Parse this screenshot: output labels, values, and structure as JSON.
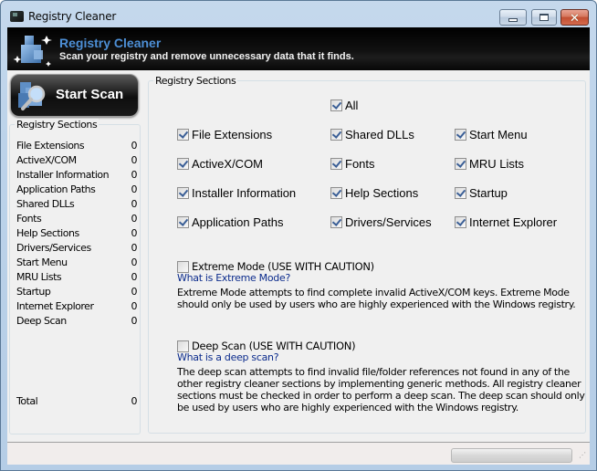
{
  "window": {
    "title": "Registry Cleaner",
    "controls": {
      "minimize": "minimize",
      "maximize": "maximize",
      "close": "close"
    }
  },
  "banner": {
    "icon": "registry-cubes-icon",
    "title": "Registry Cleaner",
    "subtitle": "Scan your registry and remove unnecessary data that it finds."
  },
  "scan_button": {
    "label": "Start Scan",
    "icon": "registry-magnifier-icon"
  },
  "left_panel": {
    "legend": "Registry Sections",
    "items": [
      {
        "label": "File Extensions",
        "count": "0"
      },
      {
        "label": "ActiveX/COM",
        "count": "0"
      },
      {
        "label": "Installer Information",
        "count": "0"
      },
      {
        "label": "Application Paths",
        "count": "0"
      },
      {
        "label": "Shared DLLs",
        "count": "0"
      },
      {
        "label": "Fonts",
        "count": "0"
      },
      {
        "label": "Help Sections",
        "count": "0"
      },
      {
        "label": "Drivers/Services",
        "count": "0"
      },
      {
        "label": "Start Menu",
        "count": "0"
      },
      {
        "label": "MRU Lists",
        "count": "0"
      },
      {
        "label": "Startup",
        "count": "0"
      },
      {
        "label": "Internet Explorer",
        "count": "0"
      },
      {
        "label": "Deep Scan",
        "count": "0"
      }
    ],
    "total": {
      "label": "Total",
      "count": "0"
    }
  },
  "right_panel": {
    "legend": "Registry Sections",
    "all": {
      "label": "All",
      "checked": true
    },
    "checkboxes": [
      {
        "label": "File Extensions",
        "checked": true
      },
      {
        "label": "ActiveX/COM",
        "checked": true
      },
      {
        "label": "Installer Information",
        "checked": true
      },
      {
        "label": "Application Paths",
        "checked": true
      },
      {
        "label": "Shared DLLs",
        "checked": true
      },
      {
        "label": "Fonts",
        "checked": true
      },
      {
        "label": "Help Sections",
        "checked": true
      },
      {
        "label": "Drivers/Services",
        "checked": true
      },
      {
        "label": "Start Menu",
        "checked": true
      },
      {
        "label": "MRU Lists",
        "checked": true
      },
      {
        "label": "Startup",
        "checked": true
      },
      {
        "label": "Internet Explorer",
        "checked": true
      }
    ],
    "extreme_mode": {
      "label": "Extreme Mode (USE WITH CAUTION)",
      "checked": false,
      "link": "What is Extreme Mode?",
      "description": "Extreme Mode attempts to find complete invalid ActiveX/COM keys. Extreme Mode should only be used by users who are highly experienced with the Windows registry."
    },
    "deep_scan": {
      "label": "Deep Scan (USE WITH CAUTION)",
      "checked": false,
      "link": "What is a deep scan?",
      "description": "The deep scan attempts to find invalid file/folder references not found in any of the other registry cleaner sections by implementing generic methods. All registry cleaner sections must be checked in order to perform a deep scan. The deep scan should only be used by users who are highly experienced with the Windows registry."
    }
  },
  "statusbar": {
    "text": "",
    "progress_percent": 0
  }
}
